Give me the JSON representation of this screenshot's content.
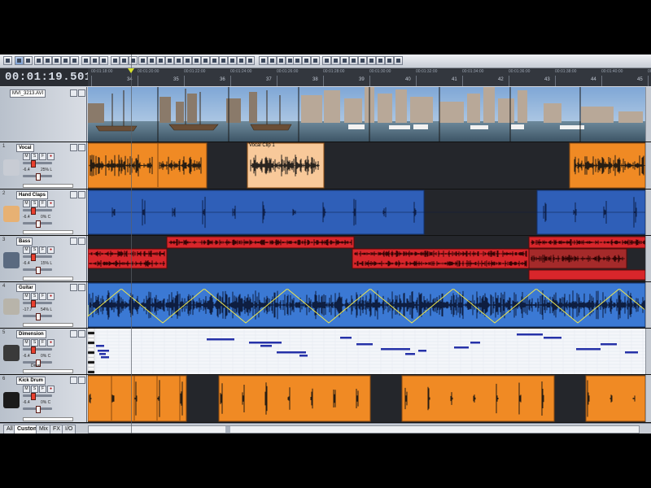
{
  "toolbar": {
    "buttons": [
      "select-tool",
      "envelope-tool",
      "draw-tool",
      "erase-tool",
      "split-tool",
      "zoom-tool",
      "time-selection-tool",
      "snap",
      "loop",
      "metronome",
      "record",
      "play",
      "stop",
      "rewind",
      "forward",
      "mixer",
      "video",
      "properties",
      "undo",
      "redo",
      "cut",
      "copy",
      "paste",
      "normalize",
      "fade-in",
      "fade-out",
      "crossfade",
      "grid",
      "markers",
      "regions",
      "tempo",
      "key",
      "chord",
      "quantize",
      "help"
    ]
  },
  "timecode": "00:01:19.501",
  "ruler": {
    "time_labels": [
      "00:01:18:00",
      "00:01:20:00",
      "00:01:22:00",
      "00:01:24:00",
      "00:01:26:00",
      "00:01:28:00",
      "00:01:30:00",
      "00:01:32:00",
      "00:01:34:00",
      "00:01:36:00",
      "00:01:38:00",
      "00:01:40:00",
      "00:01:42:00"
    ],
    "measure_labels": [
      "34",
      "35",
      "36",
      "37",
      "38",
      "39",
      "40",
      "41",
      "42",
      "43",
      "44",
      "45",
      "46"
    ]
  },
  "video_track": {
    "name": "MVI_3213.AVI"
  },
  "tracks": [
    {
      "number": "1",
      "name": "Vocal",
      "volume": "-6.4",
      "percent": "25% L",
      "icon": "microphone-icon",
      "clip_label": "Vocal Clip 1"
    },
    {
      "number": "2",
      "name": "Hand Claps",
      "volume": "-6.4",
      "percent": "0% C",
      "icon": "hands-icon"
    },
    {
      "number": "3",
      "name": "Bass",
      "volume": "-6.4",
      "percent": "15% L",
      "icon": "bass-guitar-icon"
    },
    {
      "number": "4",
      "name": "Guitar",
      "volume": "-17.7",
      "percent": "54% L",
      "icon": "guitar-icon"
    },
    {
      "number": "5",
      "name": "Dimension",
      "volume": "-6.4",
      "percent": "0% C",
      "icon": "synth-dial-icon",
      "extra": "Drive"
    },
    {
      "number": "6",
      "name": "Kick Drum",
      "volume": "-6.4",
      "percent": "0% C",
      "icon": "drum-icon"
    }
  ],
  "colors": {
    "vocal": "#f08a24",
    "vocal_selected": "#f8c99a",
    "claps": "#2f5fb8",
    "bass": "#d8262b",
    "guitar": "#3b79d4",
    "kick": "#f08a24",
    "midi_note": "#2632a8"
  },
  "bottom_tabs": [
    "All",
    "Custom",
    "Mix",
    "FX",
    "I/O"
  ]
}
